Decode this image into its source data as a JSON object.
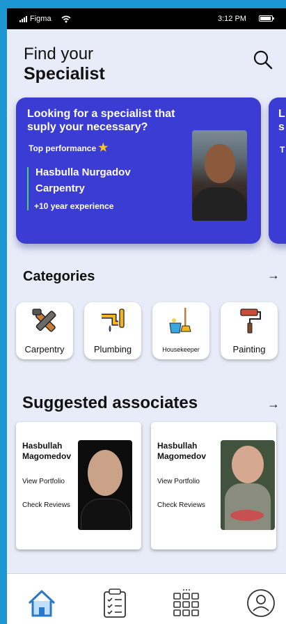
{
  "status": {
    "carrier": "Figma",
    "time": "3:12 PM"
  },
  "header": {
    "title_line1": "Find your",
    "title_line2": "Specialist"
  },
  "banner": {
    "headline": "Looking for a specialist that suply your necessary?",
    "performance_label": "Top performance",
    "name": "Hasbulla Nurgadov",
    "trade": "Carpentry",
    "experience": "+10 year experience",
    "next_peek": "L\ns",
    "next_peek2": "T"
  },
  "categories": {
    "title": "Categories",
    "items": [
      {
        "label": "Carpentry",
        "icon": "carpentry-icon"
      },
      {
        "label": "Plumbing",
        "icon": "plumbing-icon"
      },
      {
        "label": "Housekeeper",
        "icon": "housekeeper-icon"
      },
      {
        "label": "Painting",
        "icon": "paint-roller-icon"
      }
    ]
  },
  "suggested": {
    "title": "Suggested associates",
    "items": [
      {
        "name": "Hasbullah Magomedov",
        "portfolio": "View Portfolio",
        "reviews": "Check Reviews"
      },
      {
        "name": "Hasbullah Magomedov",
        "portfolio": "View Portfolio",
        "reviews": "Check Reviews"
      }
    ]
  },
  "nav": {
    "items": [
      "home-icon",
      "checklist-icon",
      "grid-icon",
      "profile-icon"
    ],
    "active_color": "#2a78c9"
  },
  "colors": {
    "banner": "#3a3cd4",
    "accent_star": "#ffc21a",
    "banner_line": "#4dd36a",
    "background": "#e8ecf8"
  }
}
